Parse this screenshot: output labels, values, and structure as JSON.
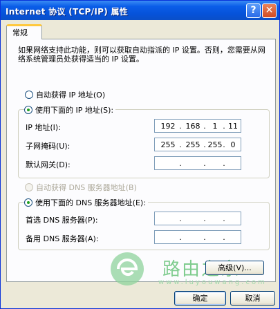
{
  "window": {
    "title": "Internet 协议 (TCP/IP) 属性"
  },
  "tabs": [
    {
      "label": "常规"
    }
  ],
  "description": "如果网络支持此功能，则可以获取自动指派的 IP 设置。否则，您需要从网络系统管理员处获得适当的 IP 设置。",
  "ip_mode": {
    "auto_label": "自动获得 IP 地址(O)",
    "manual_label": "使用下面的 IP 地址(S):",
    "selected": "manual"
  },
  "ip_fields": [
    {
      "label": "IP 地址(I):",
      "octets": [
        "192",
        "168",
        "1",
        "11"
      ]
    },
    {
      "label": "子网掩码(U):",
      "octets": [
        "255",
        "255",
        "255",
        "0"
      ]
    },
    {
      "label": "默认网关(D):",
      "octets": [
        "",
        "",
        "",
        ""
      ]
    }
  ],
  "dns_mode": {
    "auto_label": "自动获得 DNS 服务器地址(B)",
    "manual_label": "使用下面的 DNS 服务器地址(E):",
    "selected": "manual",
    "auto_disabled": true
  },
  "dns_fields": [
    {
      "label": "首选 DNS 服务器(P):",
      "octets": [
        "",
        "",
        "",
        ""
      ]
    },
    {
      "label": "备用 DNS 服务器(A):",
      "octets": [
        "",
        "",
        "",
        ""
      ]
    }
  ],
  "watermark": {
    "text": "路由之家",
    "sub": "www.luyouwang.com"
  },
  "buttons": {
    "advanced": "高级(V)...",
    "ok": "确定",
    "cancel": "取消"
  },
  "colors": {
    "titlebar": "#0652d9",
    "tab_highlight": "#ffc83c",
    "radio_dot": "#21a121",
    "watermark": "#7fcc8e"
  }
}
